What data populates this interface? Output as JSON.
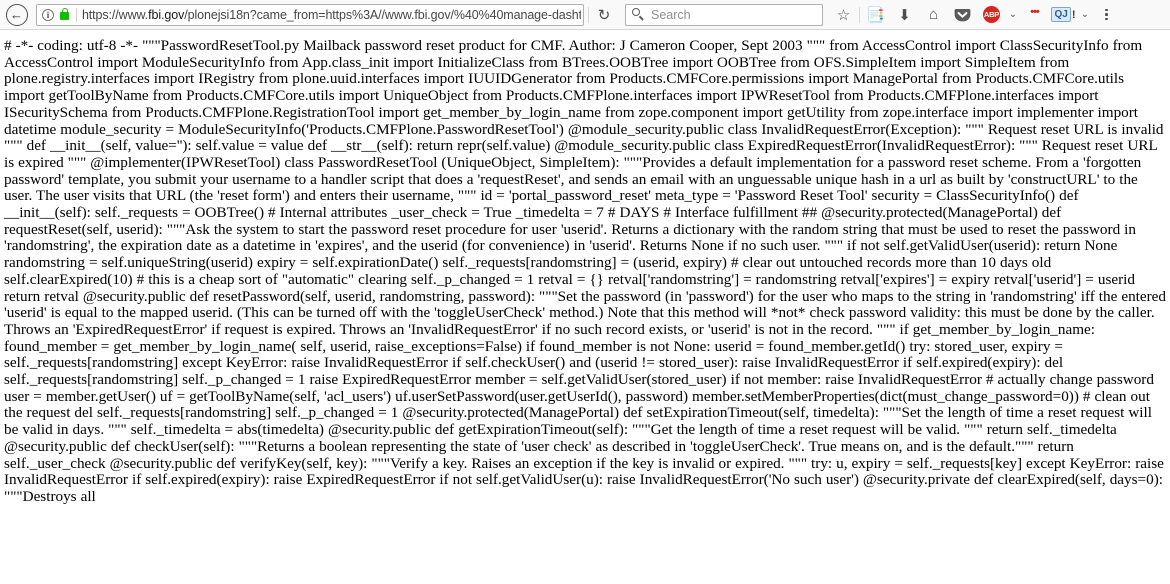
{
  "browser": {
    "back_button_label": "←",
    "identity_info_label": "i",
    "lock_icon_name": "secure-lock",
    "url_scheme": "https://www.",
    "url_host": "fbi.gov",
    "url_path": "/plonejsi18n?came_from=https%3A//www.fbi.gov/%40%40manage-dasht",
    "url_full": "https://www.fbi.gov/plonejsi18n?came_from=https%3A//www.fbi.gov/%40%40manage-dasht",
    "reload_label": "↻",
    "search_placeholder": "Search",
    "search_value": "",
    "icons": {
      "bookmark": "☆",
      "library": "📑",
      "download": "⬇",
      "home": "⌂",
      "pocket": "▼",
      "adblock_label": "ABP",
      "adblock_chevron": "⌄",
      "ghostery_dots": "•••",
      "qj_label": "QJ",
      "qj_bang": "!",
      "qj_chevron": "⌄",
      "menu": "menu-dots"
    }
  },
  "content": {
    "body_text": "# -*- coding: utf-8 -*- \"\"\"PasswordResetTool.py Mailback password reset product for CMF. Author: J Cameron Cooper, Sept 2003 \"\"\" from AccessControl import ClassSecurityInfo from AccessControl import ModuleSecurityInfo from App.class_init import InitializeClass from BTrees.OOBTree import OOBTree from OFS.SimpleItem import SimpleItem from plone.registry.interfaces import IRegistry from plone.uuid.interfaces import IUUIDGenerator from Products.CMFCore.permissions import ManagePortal from Products.CMFCore.utils import getToolByName from Products.CMFCore.utils import UniqueObject from Products.CMFPlone.interfaces import IPWResetTool from Products.CMFPlone.interfaces import ISecuritySchema from Products.CMFPlone.RegistrationTool import get_member_by_login_name from zope.component import getUtility from zope.interface import implementer import datetime module_security = ModuleSecurityInfo('Products.CMFPlone.PasswordResetTool') @module_security.public class InvalidRequestError(Exception): \"\"\" Request reset URL is invalid \"\"\" def __init__(self, value=''): self.value = value def __str__(self): return repr(self.value) @module_security.public class ExpiredRequestError(InvalidRequestError): \"\"\" Request reset URL is expired \"\"\" @implementer(IPWResetTool) class PasswordResetTool (UniqueObject, SimpleItem): \"\"\"Provides a default implementation for a password reset scheme. From a 'forgotten password' template, you submit your username to a handler script that does a 'requestReset', and sends an email with an unguessable unique hash in a url as built by 'constructURL' to the user. The user visits that URL (the 'reset form') and enters their username, \"\"\" id = 'portal_password_reset' meta_type = 'Password Reset Tool' security = ClassSecurityInfo() def __init__(self): self._requests = OOBTree() # Internal attributes _user_check = True _timedelta = 7 # DAYS # Interface fulfillment ## @security.protected(ManagePortal) def requestReset(self, userid): \"\"\"Ask the system to start the password reset procedure for user 'userid'. Returns a dictionary with the random string that must be used to reset the password in 'randomstring', the expiration date as a datetime in 'expires', and the userid (for convenience) in 'userid'. Returns None if no such user. \"\"\" if not self.getValidUser(userid): return None randomstring = self.uniqueString(userid) expiry = self.expirationDate() self._requests[randomstring] = (userid, expiry) # clear out untouched records more than 10 days old self.clearExpired(10) # this is a cheap sort of \"automatic\" clearing self._p_changed = 1 retval = {} retval['randomstring'] = randomstring retval['expires'] = expiry retval['userid'] = userid return retval @security.public def resetPassword(self, userid, randomstring, password): \"\"\"Set the password (in 'password') for the user who maps to the string in 'randomstring' iff the entered 'userid' is equal to the mapped userid. (This can be turned off with the 'toggleUserCheck' method.) Note that this method will *not* check password validity: this must be done by the caller. Throws an 'ExpiredRequestError' if request is expired. Throws an 'InvalidRequestError' if no such record exists, or 'userid' is not in the record. \"\"\" if get_member_by_login_name: found_member = get_member_by_login_name( self, userid, raise_exceptions=False) if found_member is not None: userid = found_member.getId() try: stored_user, expiry = self._requests[randomstring] except KeyError: raise InvalidRequestError if self.checkUser() and (userid != stored_user): raise InvalidRequestError if self.expired(expiry): del self._requests[randomstring] self._p_changed = 1 raise ExpiredRequestError member = self.getValidUser(stored_user) if not member: raise InvalidRequestError # actually change password user = member.getUser() uf = getToolByName(self, 'acl_users') uf.userSetPassword(user.getUserId(), password) member.setMemberProperties(dict(must_change_password=0)) # clean out the request del self._requests[randomstring] self._p_changed = 1 @security.protected(ManagePortal) def setExpirationTimeout(self, timedelta): \"\"\"Set the length of time a reset request will be valid in days. \"\"\" self._timedelta = abs(timedelta) @security.public def getExpirationTimeout(self): \"\"\"Get the length of time a reset request will be valid. \"\"\" return self._timedelta @security.public def checkUser(self): \"\"\"Returns a boolean representing the state of 'user check' as described in 'toggleUserCheck'. True means on, and is the default.\"\"\" return self._user_check @security.public def verifyKey(self, key): \"\"\"Verify a key. Raises an exception if the key is invalid or expired. \"\"\" try: u, expiry = self._requests[key] except KeyError: raise InvalidRequestError if self.expired(expiry): raise ExpiredRequestError if not self.getValidUser(u): raise InvalidRequestError('No such user') @security.private def clearExpired(self, days=0): \"\"\"Destroys all"
  }
}
